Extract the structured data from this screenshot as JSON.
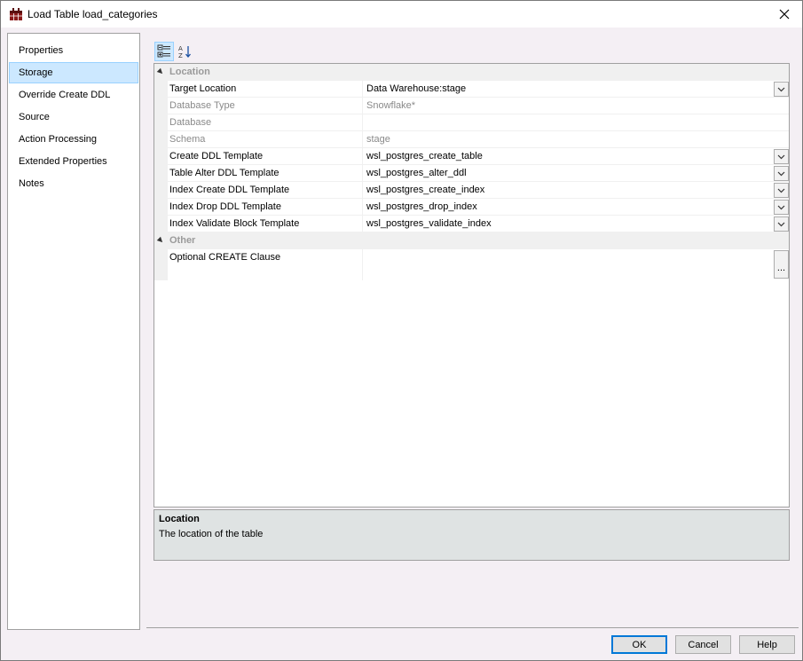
{
  "window": {
    "title": "Load Table load_categories"
  },
  "nav": {
    "items": [
      {
        "label": "Properties",
        "selected": false
      },
      {
        "label": "Storage",
        "selected": true
      },
      {
        "label": "Override Create DDL",
        "selected": false
      },
      {
        "label": "Source",
        "selected": false
      },
      {
        "label": "Action Processing",
        "selected": false
      },
      {
        "label": "Extended Properties",
        "selected": false
      },
      {
        "label": "Notes",
        "selected": false
      }
    ]
  },
  "toolbar": {
    "categorized_icon": "categorized-icon",
    "alphabetical_icon": "sort-az-icon"
  },
  "grid": {
    "categories": {
      "location": "Location",
      "other": "Other"
    },
    "location_rows": [
      {
        "name": "Target Location",
        "value": "Data Warehouse:stage",
        "disabled": false,
        "dropdown": true
      },
      {
        "name": "Database Type",
        "value": "Snowflake*",
        "disabled": true,
        "dropdown": false
      },
      {
        "name": "Database",
        "value": "",
        "disabled": true,
        "dropdown": false
      },
      {
        "name": "Schema",
        "value": "stage",
        "disabled": true,
        "dropdown": false
      },
      {
        "name": "Create DDL Template",
        "value": "wsl_postgres_create_table",
        "disabled": false,
        "dropdown": true
      },
      {
        "name": "Table Alter DDL Template",
        "value": "wsl_postgres_alter_ddl",
        "disabled": false,
        "dropdown": true
      },
      {
        "name": "Index Create DDL Template",
        "value": "wsl_postgres_create_index",
        "disabled": false,
        "dropdown": true
      },
      {
        "name": "Index Drop DDL Template",
        "value": "wsl_postgres_drop_index",
        "disabled": false,
        "dropdown": true
      },
      {
        "name": "Index Validate Block Template",
        "value": "wsl_postgres_validate_index",
        "disabled": false,
        "dropdown": true
      }
    ],
    "other_rows": [
      {
        "name": "Optional CREATE Clause",
        "value": "",
        "button": "..."
      }
    ]
  },
  "description": {
    "title": "Location",
    "text": "The location of the table"
  },
  "buttons": {
    "ok": "OK",
    "cancel": "Cancel",
    "help": "Help"
  },
  "colors": {
    "selection": "#cce8ff",
    "panel_bg": "#f4eff4",
    "description_bg": "#dfe3e3",
    "disabled_text": "#8a8a8a"
  }
}
